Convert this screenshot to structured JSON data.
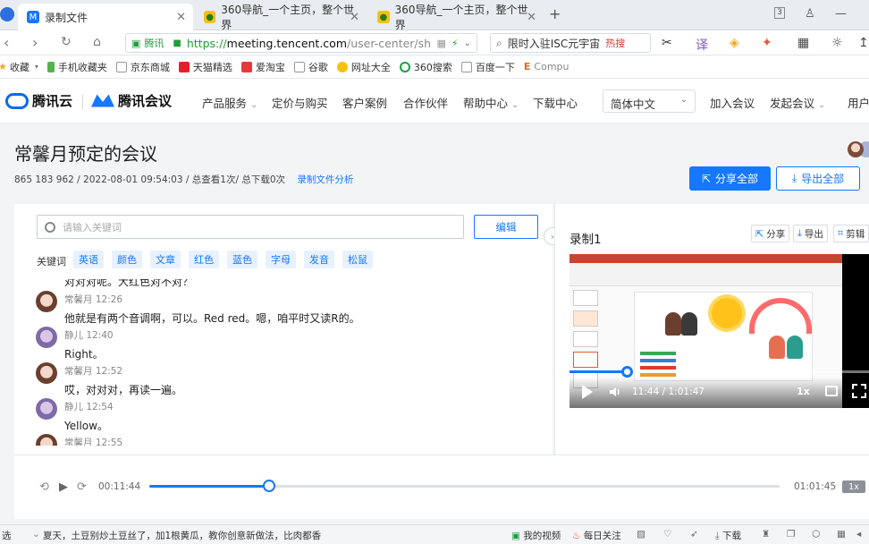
{
  "browser": {
    "tabs": [
      {
        "label": "录制文件",
        "active": true
      },
      {
        "label": "360导航_一个主页，整个世界",
        "active": false
      },
      {
        "label": "360导航_一个主页，整个世界",
        "active": false
      }
    ],
    "new_tab_symbol": "+",
    "tab_count": "3",
    "address": {
      "cert": "腾讯",
      "protocol": "https://",
      "host": "meeting.tencent.com",
      "path": "/user-center/sh"
    },
    "search": {
      "text": "限时入驻ISC元宇宙",
      "hot": "热搜"
    },
    "bookmarks": [
      "收藏",
      "手机收藏夹",
      "京东商城",
      "天猫精选",
      "爱淘宝",
      "谷歌",
      "网址大全",
      "360搜索",
      "百度一下",
      "Compu"
    ]
  },
  "site": {
    "logo_cloud": "腾讯云",
    "logo_meeting": "腾讯会议",
    "nav": [
      "产品服务",
      "定价与购买",
      "客户案例",
      "合作伙伴",
      "帮助中心",
      "下载中心"
    ],
    "language": "简体中文",
    "join": "加入会议",
    "start": "发起会议",
    "user": "用户"
  },
  "page": {
    "title": "常馨月预定的会议",
    "meeting_id": "865 183 962",
    "datetime": "/ 2022-08-01 09:54:03",
    "stats": "/ 总查看1次/ 总下载0次",
    "analysis_link": "录制文件分析",
    "share_all": "分享全部",
    "export_all": "导出全部"
  },
  "transcript": {
    "search_placeholder": "请输入关键词",
    "edit": "编辑",
    "keyword_label": "关键词",
    "keywords": [
      "英语",
      "颜色",
      "文章",
      "红色",
      "蓝色",
      "字母",
      "发音",
      "松鼠"
    ],
    "cut_line": "对对对呢。大红色对不对？",
    "messages": [
      {
        "speaker": "常馨月",
        "time": "12:26",
        "text": "他就是有两个音调啊，可以。Red red。嗯，咱平时又读R的。",
        "avatar": "girl"
      },
      {
        "speaker": "静儿",
        "time": "12:40",
        "text": "Right。",
        "avatar": "jing"
      },
      {
        "speaker": "常馨月",
        "time": "12:52",
        "text": "哎，对对对，再读一遍。",
        "avatar": "girl"
      },
      {
        "speaker": "静儿",
        "time": "12:54",
        "text": "Yellow。",
        "avatar": "jing"
      },
      {
        "speaker": "常馨月",
        "time": "12:55",
        "text": "",
        "avatar": "girl"
      }
    ]
  },
  "recording": {
    "title": "录制1",
    "share": "分享",
    "export": "导出",
    "edit": "剪辑",
    "current_time": "11:44",
    "total_time": "1:01:47",
    "progress": 0.19,
    "speed": "1x"
  },
  "player": {
    "current": "00:11:44",
    "total": "01:01:45",
    "progress": 0.19,
    "speed": "1x"
  },
  "statusbar": {
    "left": "选",
    "news": "夏天，土豆别炒土豆丝了，加1根黄瓜，教你创意新做法，比肉都香",
    "my_video": "我的视频",
    "daily": "每日关注",
    "download": "下载"
  }
}
